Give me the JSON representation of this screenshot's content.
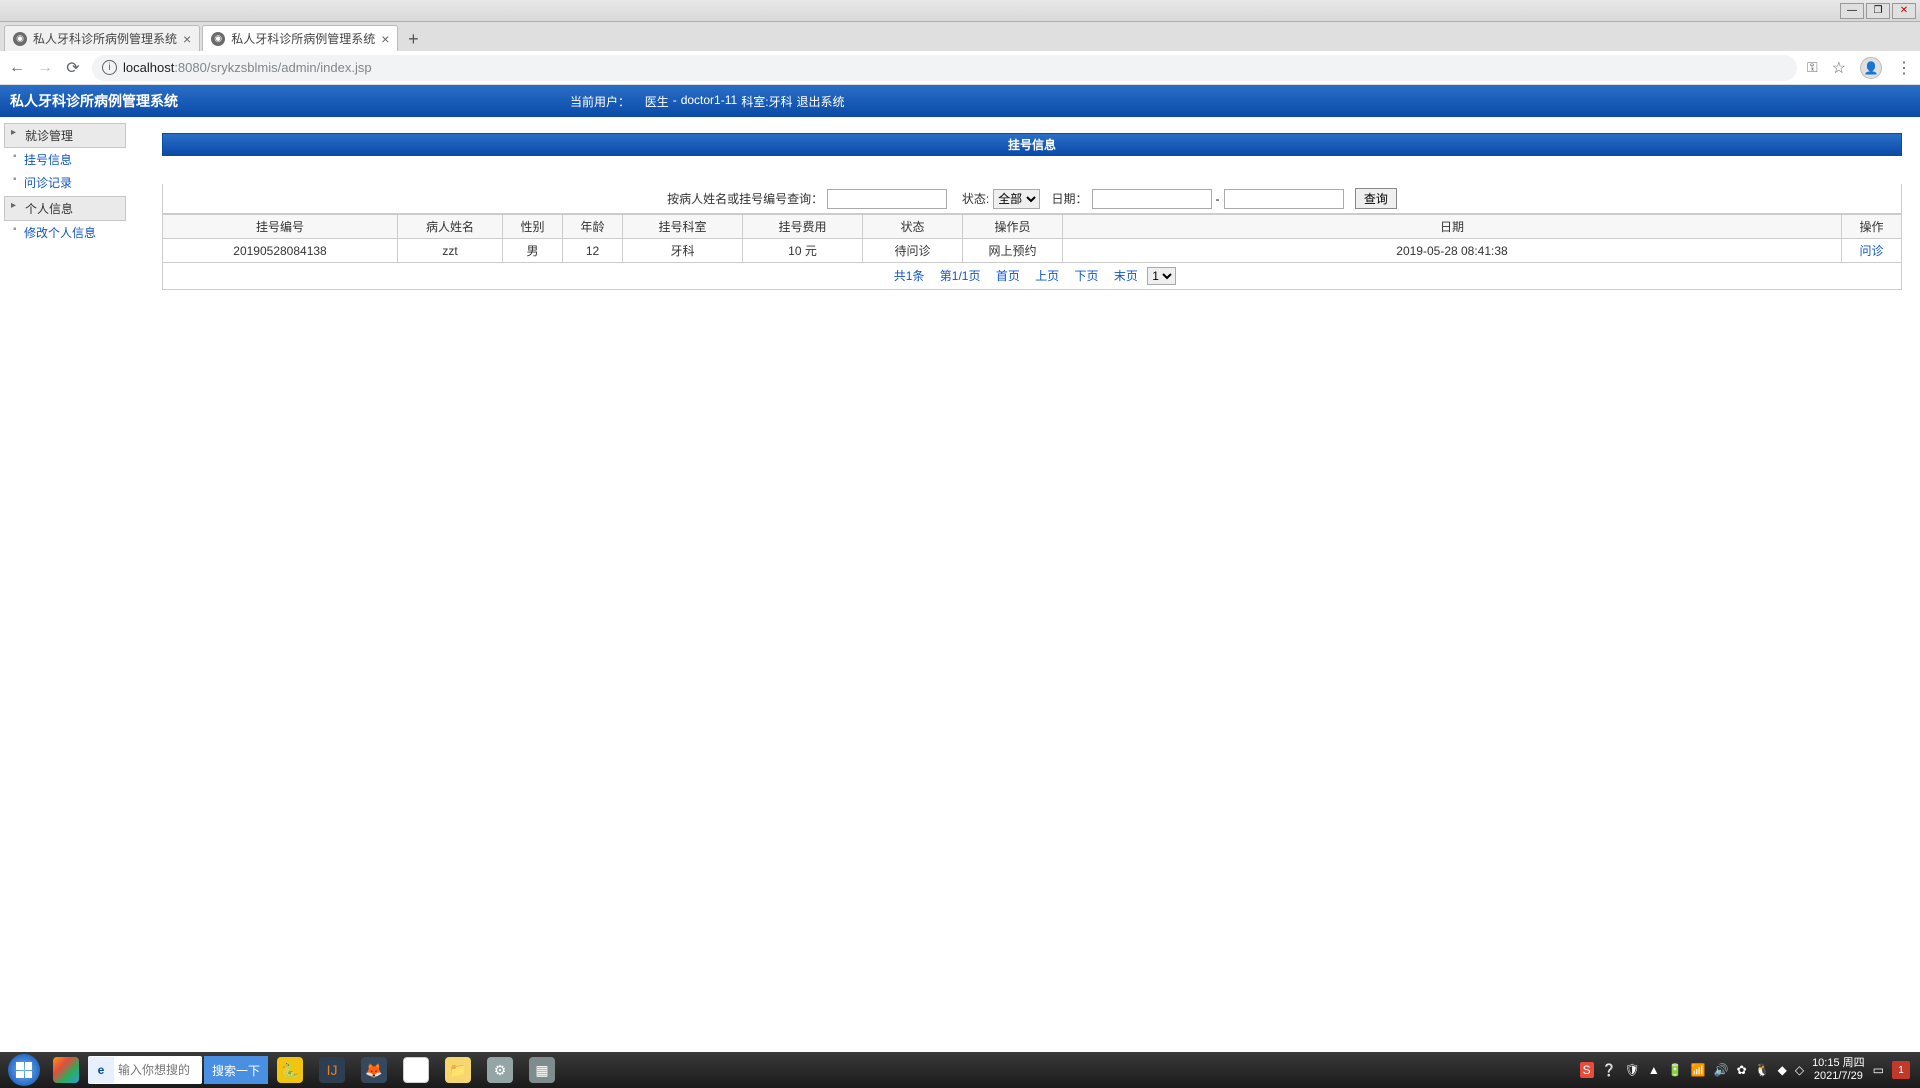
{
  "window_buttons": {
    "min": "—",
    "max": "❐",
    "close": "✕"
  },
  "browser": {
    "tabs": [
      {
        "title": "私人牙科诊所病例管理系统",
        "active": false
      },
      {
        "title": "私人牙科诊所病例管理系统",
        "active": true
      }
    ],
    "url_host": "localhost",
    "url_port_path": ":8080/srykzsblmis/admin/index.jsp"
  },
  "app_header": {
    "title": "私人牙科诊所病例管理系统",
    "user_label": "当前用户：",
    "role": "医生",
    "username": "doctor1-11",
    "dept_label": "科室:牙科",
    "logout": "退出系统"
  },
  "sidebar": {
    "groups": [
      {
        "label": "就诊管理",
        "items": [
          {
            "label": "挂号信息"
          },
          {
            "label": "问诊记录"
          }
        ]
      },
      {
        "label": "个人信息",
        "items": [
          {
            "label": "修改个人信息"
          }
        ]
      }
    ]
  },
  "panel": {
    "title": "挂号信息",
    "filter": {
      "name_label": "按病人姓名或挂号编号查询：",
      "status_label": "状态:",
      "status_options": [
        "全部"
      ],
      "status_value": "全部",
      "date_label": "日期：",
      "date_sep": "-",
      "search_btn": "查询"
    },
    "columns": [
      "挂号编号",
      "病人姓名",
      "性别",
      "年龄",
      "挂号科室",
      "挂号费用",
      "状态",
      "操作员",
      "日期",
      "操作"
    ],
    "rows": [
      {
        "id": "20190528084138",
        "name": "zzt",
        "gender": "男",
        "age": "12",
        "dept": "牙科",
        "fee": "10 元",
        "status": "待问诊",
        "operator": "网上预约",
        "date": "2019-05-28 08:41:38",
        "action": "问诊"
      }
    ],
    "pagination": {
      "total": "共1条",
      "page_info": "第1/1页",
      "first": "首页",
      "prev": "上页",
      "next": "下页",
      "last": "末页",
      "page_select": "1"
    }
  },
  "taskbar": {
    "search_placeholder": "输入你想搜的",
    "search_btn": "搜索一下",
    "clock_time": "10:15",
    "clock_day": "周四",
    "clock_date": "2021/7/29",
    "notif_count": "1"
  }
}
